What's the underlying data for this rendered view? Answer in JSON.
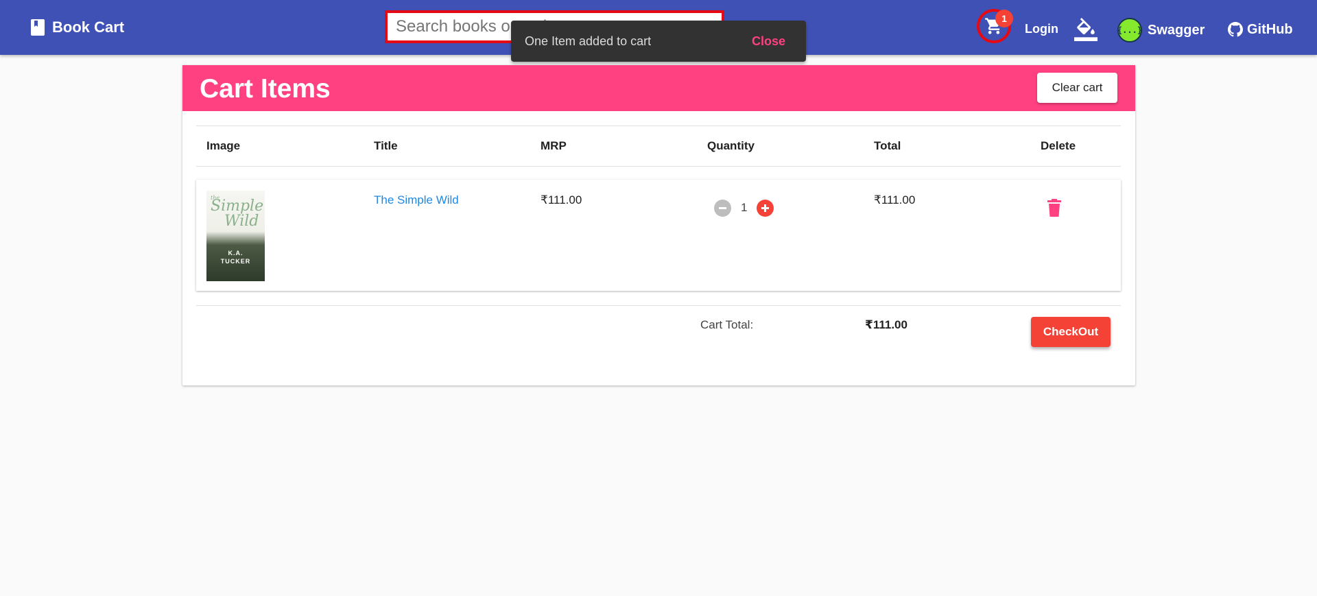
{
  "app": {
    "brand": "Book Cart"
  },
  "search": {
    "placeholder": "Search books or authors"
  },
  "nav": {
    "cart_count": "1",
    "login": "Login",
    "swagger": "Swagger",
    "swagger_logo": "{...}",
    "github": "GitHub"
  },
  "snackbar": {
    "message": "One Item added to cart",
    "action": "Close"
  },
  "cart": {
    "title": "Cart Items",
    "clear_label": "Clear cart",
    "columns": [
      "Image",
      "Title",
      "MRP",
      "Quantity",
      "Total",
      "Delete"
    ],
    "items": [
      {
        "cover": {
          "line1": "the",
          "line2": "Simple",
          "line3": "Wild",
          "author1": "K.A.",
          "author2": "TUCKER"
        },
        "title": "The Simple Wild",
        "mrp": "₹111.00",
        "quantity": "1",
        "total": "₹111.00"
      }
    ],
    "total_label": "Cart Total:",
    "total_value": "₹111.00",
    "checkout_label": "CheckOut"
  },
  "colors": {
    "toolbar": "#3f51b5",
    "header": "#ff4081",
    "accent": "#f44336",
    "link": "#1e88e5"
  },
  "icons": [
    "book-icon",
    "cart-icon",
    "paint-bucket-icon",
    "swagger-icon",
    "github-icon",
    "minus-icon",
    "plus-icon",
    "trash-icon"
  ]
}
